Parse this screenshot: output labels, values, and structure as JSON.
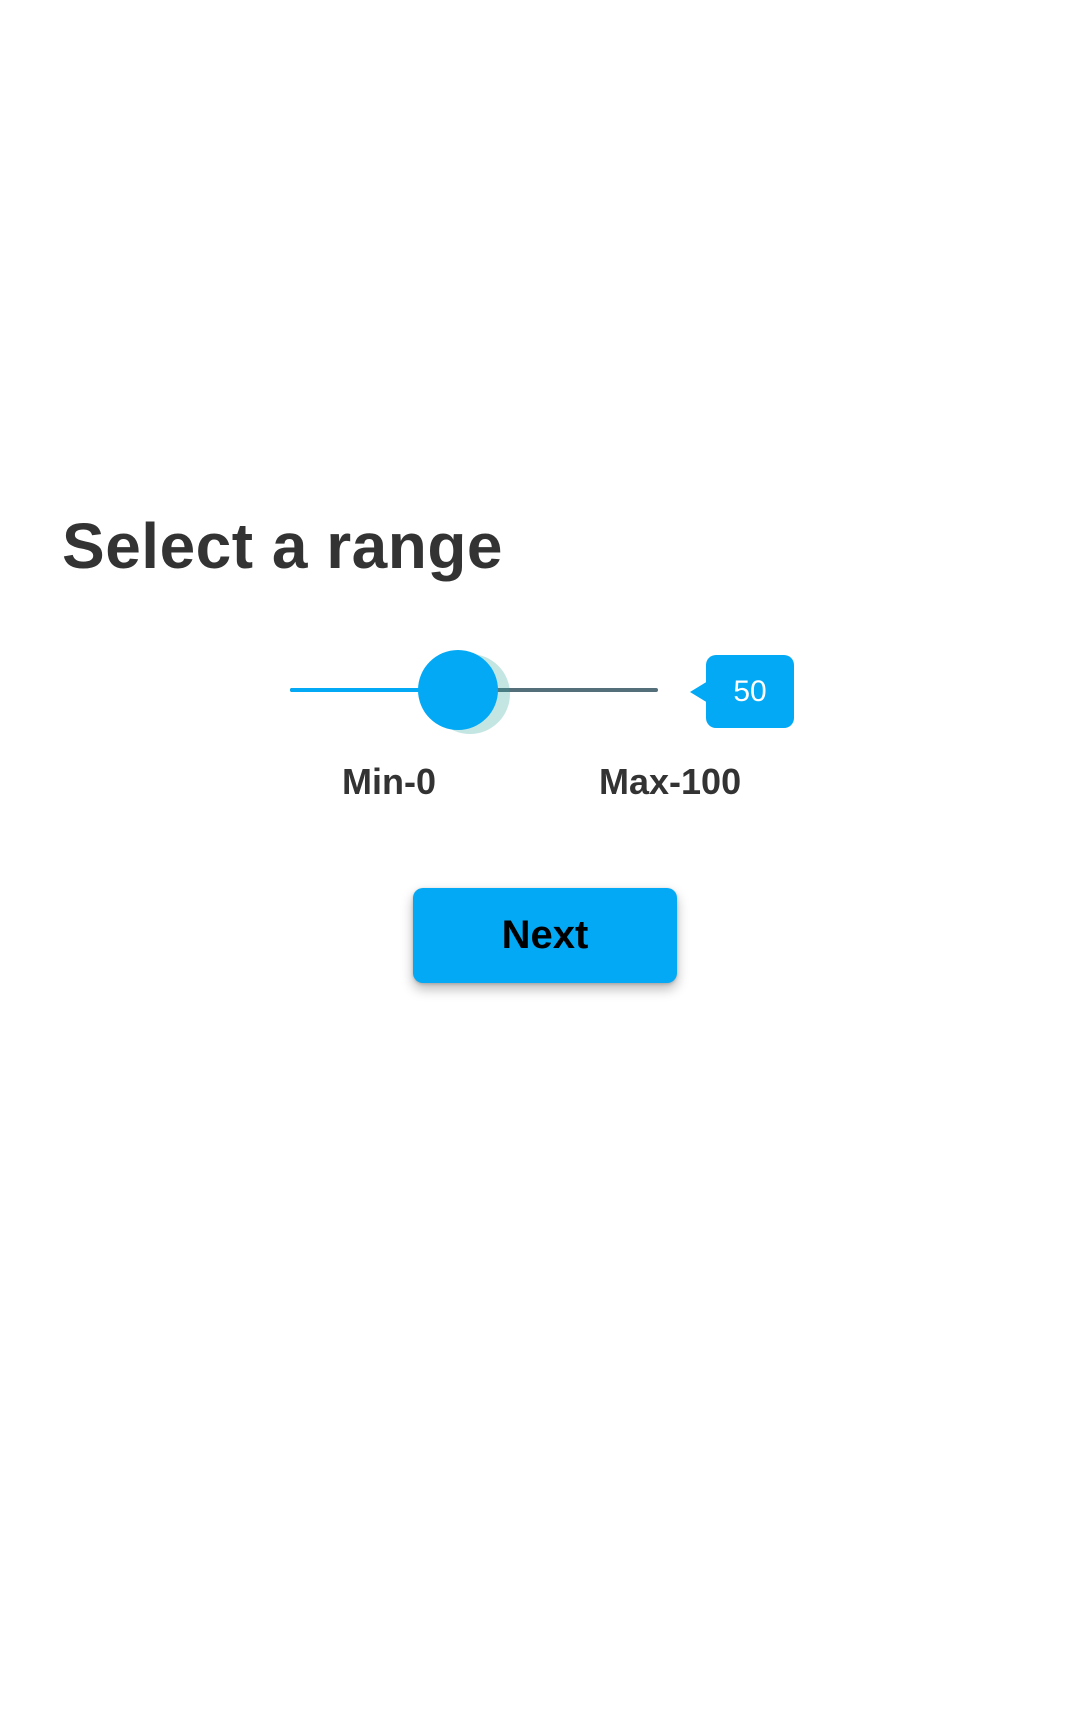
{
  "screen": {
    "title": "Select a range"
  },
  "slider": {
    "min": 0,
    "max": 100,
    "value": 50,
    "value_text": "50",
    "min_label": "Min-0",
    "max_label": "Max-100",
    "fraction": 0.5
  },
  "actions": {
    "next_label": "Next"
  },
  "colors": {
    "accent": "#03a9f4",
    "track_inactive": "#546e7a",
    "thumb_halo": "#26a69a",
    "text": "#333333",
    "background": "#ffffff"
  }
}
